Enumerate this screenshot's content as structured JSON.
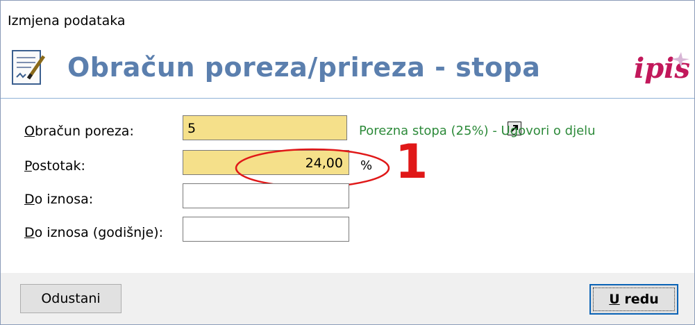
{
  "window": {
    "title": "Izmjena podataka"
  },
  "header": {
    "heading": "Obračun poreza/prireza - stopa",
    "logo_text": "ipis"
  },
  "form": {
    "obracun": {
      "label_prefix": "O",
      "label_rest": "bračun poreza:",
      "value": "5",
      "note": "Porezna stopa (25%) - Ugovori o djelu"
    },
    "postotak": {
      "label_prefix": "P",
      "label_rest": "ostotak:",
      "value": "24,00",
      "unit": "%"
    },
    "do_iznosa": {
      "label_prefix": "D",
      "label_rest": "o iznosa:",
      "value": ""
    },
    "do_iznosa_god": {
      "label_prefix": "D",
      "label_rest": "o iznosa (godišnje):",
      "value": ""
    }
  },
  "annotation": {
    "marker": "1",
    "color": "#e01818"
  },
  "footer": {
    "cancel_label": "Odustani",
    "ok_prefix": "U",
    "ok_rest": " redu"
  },
  "colors": {
    "accent": "#5b7fae",
    "field_highlight": "#f5e08a",
    "note_green": "#2d8a3a",
    "logo": "#c2185b"
  }
}
